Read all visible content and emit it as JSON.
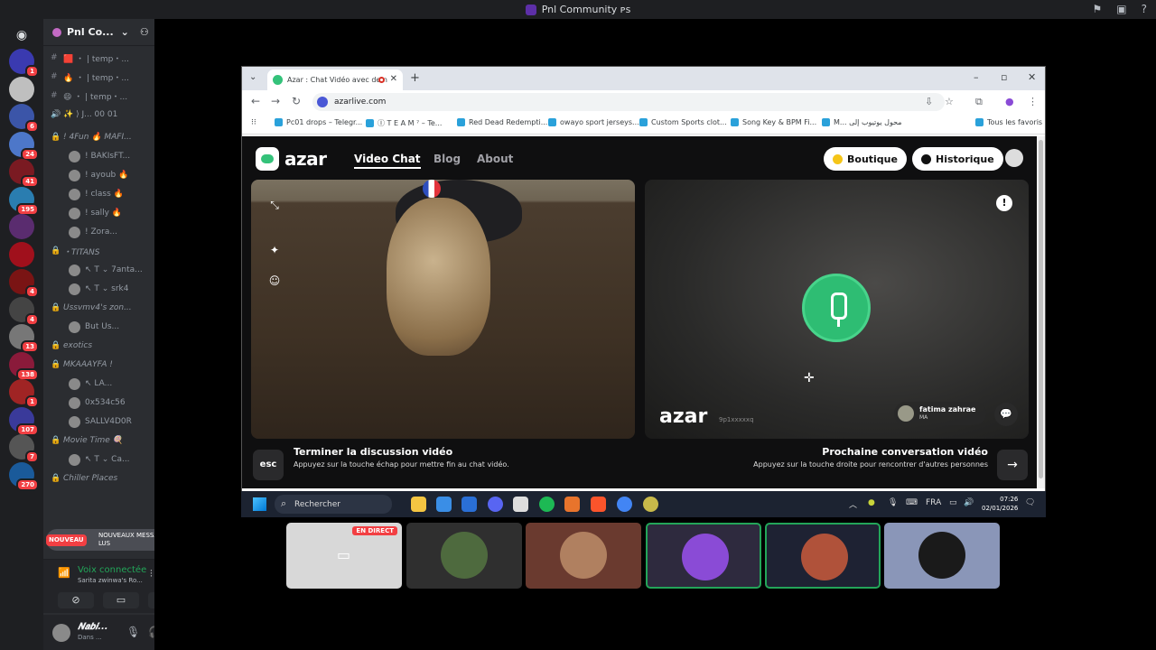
{
  "topbar": {
    "title": "Pnl Community ᴘs"
  },
  "guilds": [
    {
      "badge": "1",
      "color": "#3a3ab0"
    },
    {
      "badge": "",
      "color": "#bfbfbf"
    },
    {
      "badge": "6",
      "color": "#3b55a8"
    },
    {
      "badge": "24",
      "color": "#4d77c9"
    },
    {
      "badge": "41",
      "color": "#7a1a22"
    },
    {
      "badge": "195",
      "color": "#2a7db0"
    },
    {
      "badge": "",
      "color": "#5a2c6f"
    },
    {
      "badge": "",
      "color": "#a0101c"
    },
    {
      "badge": "4",
      "color": "#7a1414"
    },
    {
      "badge": "4",
      "color": "#444"
    },
    {
      "badge": "13",
      "color": "#777"
    },
    {
      "badge": "138",
      "color": "#8a1a3a"
    },
    {
      "badge": "1",
      "color": "#a02424"
    },
    {
      "badge": "107",
      "color": "#3a3a9a"
    },
    {
      "badge": "7",
      "color": "#555"
    },
    {
      "badge": "270",
      "color": "#1a5a9a"
    }
  ],
  "server": {
    "name": "Pnl Co...",
    "channels": [
      {
        "pre": "#",
        "label": "🟥 ・ | temp・..."
      },
      {
        "pre": "#",
        "label": "🔥 ・ | temp・..."
      },
      {
        "pre": "#",
        "label": "😄 ・ | temp・..."
      },
      {
        "pre": "🔊",
        "label": "✨ ⟩ J...  00 01"
      }
    ],
    "voice_channels": [
      {
        "name": "! 4Fun 🔥 MAFI...",
        "members": [
          "! BAKIsFT...",
          "! ayoub 🔥",
          "! class 🔥",
          "! sally 🔥",
          "! Zora..."
        ]
      },
      {
        "name": "・TITANS",
        "members": [
          "↖ T ⌄  7anta...",
          "↖ T ⌄  srk4"
        ]
      },
      {
        "name": "Ussvmv4's zon...",
        "members": [
          "But Us..."
        ]
      },
      {
        "name": "exotics",
        "members": []
      },
      {
        "name": "MKAAAYFA !",
        "members": [
          "↖ LA...",
          "0x534c56",
          "SALLV4D0R"
        ]
      },
      {
        "name": "Movie Time 🍭",
        "members": [
          "↖ T ⌄  Ca..."
        ]
      },
      {
        "name": "Chiller Places",
        "members": []
      }
    ]
  },
  "new_messages": {
    "badge": "NOUVEAU",
    "text": "NOUVEAUX MESSAGES NON LUS"
  },
  "voice": {
    "status": "Voix connectée",
    "channel": "Sarita zwinwa's Ro..."
  },
  "user": {
    "name": "𝑵𝒂𝒃𝒊...",
    "status": "Dans ..."
  },
  "browser": {
    "tab_title": "Azar : Chat Vidéo avec de n",
    "url": "azarlive.com",
    "bookmarks": [
      "Pc01 drops – Telegr...",
      "Ⓘ T E A M ⁷ – Te...",
      "Red Dead Redempti...",
      "owayo sport jerseys...",
      "Custom Sports clot...",
      "Song Key & BPM Fi...",
      "M... محول يوتيوب إلى",
      "Tous les favoris"
    ]
  },
  "azar": {
    "logo": "azar",
    "nav": [
      "Video Chat",
      "Blog",
      "About"
    ],
    "boutique": "Boutique",
    "historique": "Historique",
    "watermark": "azar",
    "watermark_id": "9p1xxxxxq",
    "peer_name": "fatima zahrae",
    "peer_country": "MA",
    "esc_key": "esc",
    "end_title": "Terminer la discussion vidéo",
    "end_sub": "Appuyez sur la touche échap pour mettre fin au chat vidéo.",
    "next_title": "Prochaine conversation vidéo",
    "next_sub": "Appuyez sur la touche droite pour rencontrer d'autres personnes"
  },
  "taskbar": {
    "search": "Rechercher",
    "lang": "FRA",
    "time": "07:26",
    "date": "02/01/2026"
  },
  "stream_tiles": {
    "live_label": "EN DIRECT"
  }
}
